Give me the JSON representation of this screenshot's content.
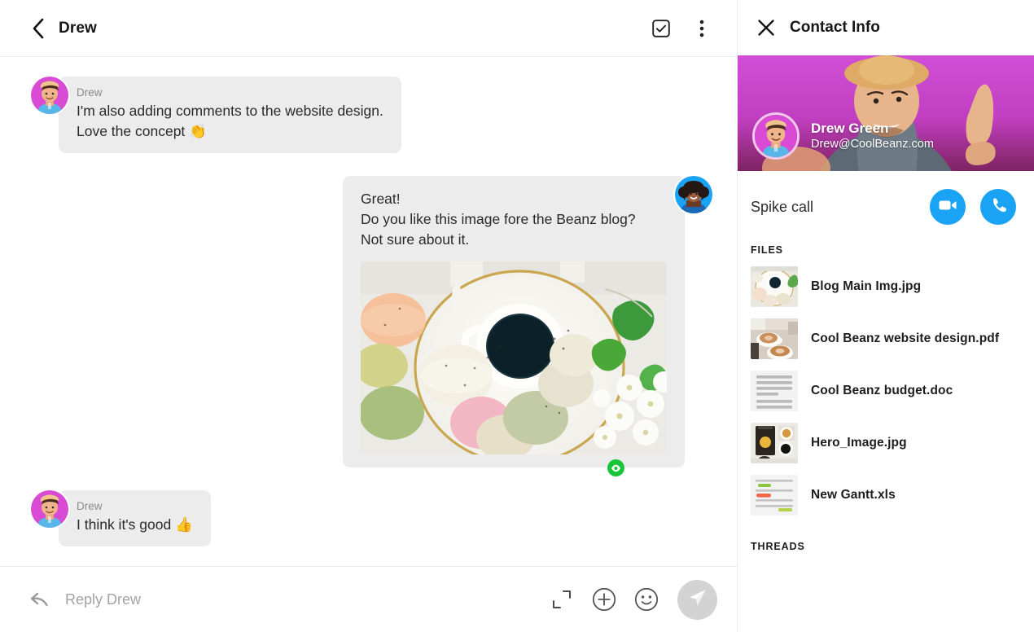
{
  "chat": {
    "header": {
      "back_icon": "chevron-left-icon",
      "title": "Drew",
      "tasks_icon": "checkbox-square-icon",
      "more_icon": "more-vertical-icon"
    },
    "messages": [
      {
        "id": "m1",
        "direction": "in",
        "sender": "Drew",
        "avatar_icon": "avatar-drew",
        "lines": [
          "I'm also adding comments to the website design.",
          "Love the concept 👏"
        ],
        "has_image": false
      },
      {
        "id": "m2",
        "direction": "out",
        "sender": "",
        "avatar_icon": "avatar-me",
        "lines": [
          "Great!",
          "Do you like this image fore the Beanz blog?",
          "Not sure about it."
        ],
        "has_image": true,
        "image_alt": "macarons-and-coffee-photo",
        "read_badge_icon": "eye-icon"
      },
      {
        "id": "m3",
        "direction": "in",
        "sender": "Drew",
        "avatar_icon": "avatar-drew",
        "lines": [
          "I think it's good 👍"
        ],
        "has_image": false
      }
    ],
    "composer": {
      "reply_icon": "reply-arrow-icon",
      "placeholder": "Reply Drew",
      "value": "",
      "expand_icon": "expand-corners-icon",
      "attach_icon": "plus-circle-icon",
      "emoji_icon": "smiley-icon",
      "send_icon": "send-paper-plane-icon"
    }
  },
  "contact": {
    "close_icon": "close-x-icon",
    "title": "Contact Info",
    "cover": {
      "background_color": "#c738c7",
      "photo_alt": "man-in-straw-hat-photo",
      "avatar_icon": "avatar-drew",
      "name": "Drew Green",
      "email": "Drew@CoolBeanz.com"
    },
    "call": {
      "label": "Spike call",
      "video_icon": "video-camera-icon",
      "phone_icon": "phone-icon",
      "button_color": "#1aa3f5"
    },
    "files_label": "FILES",
    "files": [
      {
        "name": "Blog Main Img.jpg",
        "thumb": "photo-macarons-coffee"
      },
      {
        "name": "Cool Beanz website design.pdf",
        "thumb": "photo-two-lattes"
      },
      {
        "name": "Cool Beanz budget.doc",
        "thumb": "doc-lines"
      },
      {
        "name": "Hero_Image.jpg",
        "thumb": "photo-coffee-bag"
      },
      {
        "name": "New Gantt.xls",
        "thumb": "gantt-lines"
      }
    ],
    "threads_label": "THREADS"
  }
}
